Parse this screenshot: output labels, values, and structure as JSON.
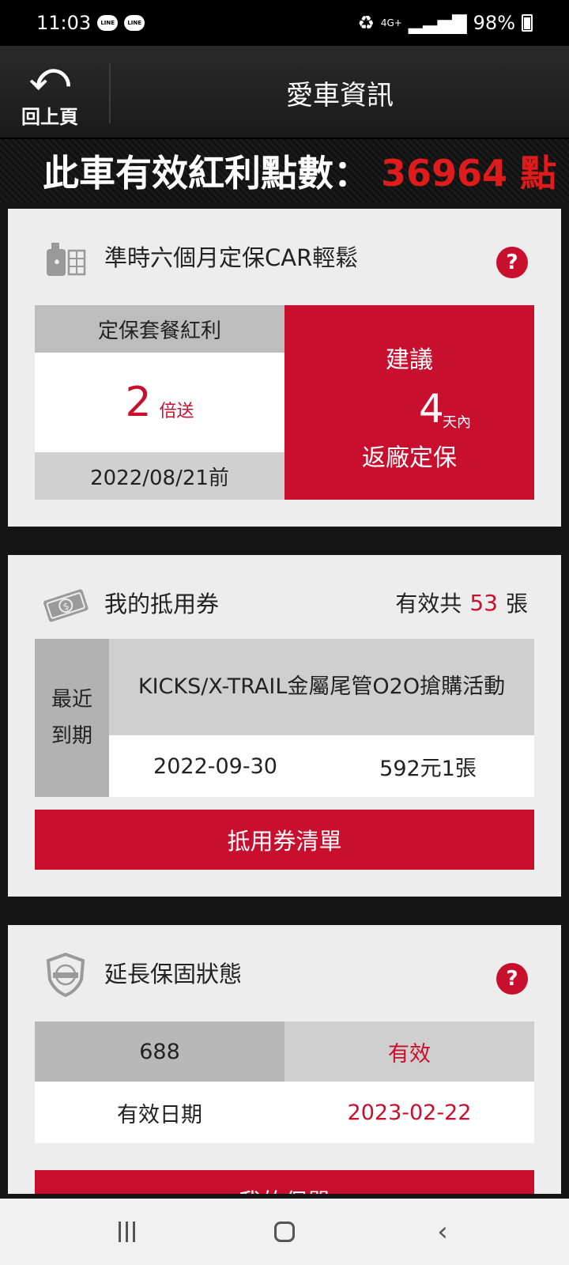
{
  "status_bar": {
    "time": "11:03",
    "app_icons": [
      "LINE",
      "LINE"
    ],
    "network": "4G+",
    "battery": "98%"
  },
  "header": {
    "back_label": "回上頁",
    "title": "愛車資訊"
  },
  "points": {
    "label": "此車有效紅利點數：",
    "value": "36964",
    "unit": "點"
  },
  "maintenance": {
    "title": "準時六個月定保CAR輕鬆",
    "bonus_header": "定保套餐紅利",
    "multiplier": "2",
    "multiplier_unit": "倍送",
    "deadline": "2022/08/21前",
    "suggest_label": "建議",
    "days": "4",
    "days_unit": "天內",
    "action": "返廠定保"
  },
  "coupons": {
    "title": "我的抵用券",
    "count_prefix": "有效共",
    "count": "53",
    "count_unit": "張",
    "side_label_1": "最近",
    "side_label_2": "到期",
    "coupon_name": "KICKS/X-TRAIL金屬尾管O2O搶購活動",
    "expiry": "2022-09-30",
    "value": "592元1張",
    "list_button": "抵用券清單"
  },
  "warranty": {
    "title": "延長保固狀態",
    "code": "688",
    "status": "有效",
    "date_label": "有效日期",
    "date": "2023-02-22",
    "button": "我的保單"
  },
  "colors": {
    "accent": "#c8102e",
    "points_red": "#e01b1b"
  }
}
